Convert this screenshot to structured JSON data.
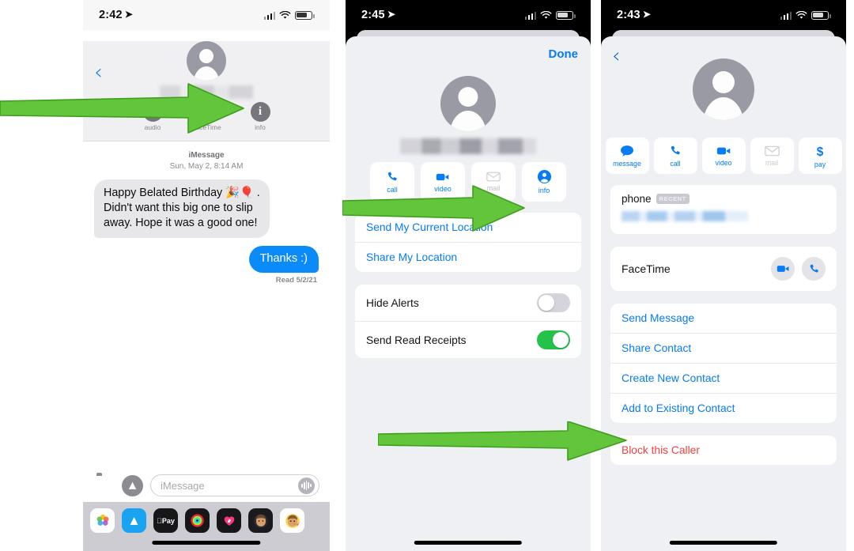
{
  "panels": {
    "messages": {
      "status": {
        "time": "2:42",
        "location_icon": "location-arrow-icon"
      },
      "back_icon": "back-chevron-icon",
      "contact_name_redacted": "",
      "header_actions": [
        {
          "label": "audio",
          "icon": "phone-icon"
        },
        {
          "label": "FaceTime",
          "icon": "video-icon"
        },
        {
          "label": "info",
          "icon": "info-icon"
        }
      ],
      "thread_service": "iMessage",
      "thread_date": "Sun, May 2, 8:14 AM",
      "messages": [
        {
          "from": "them",
          "text": "Happy Belated Birthday 🎉🎈 . Didn't want this big one to slip away. Hope it was a good one!"
        },
        {
          "from": "me",
          "text": "Thanks :)"
        }
      ],
      "read_receipt": "Read 5/2/21",
      "input_placeholder": "iMessage",
      "camera_icon": "camera-icon",
      "appstore_icon": "app-store-icon",
      "mic_icon": "audio-waveform-icon",
      "app_drawer": [
        {
          "name": "photos-app-icon"
        },
        {
          "name": "app-store-app-icon"
        },
        {
          "name": "apple-pay-app-icon",
          "label": "Pay"
        },
        {
          "name": "activity-rings-app-icon"
        },
        {
          "name": "fitness-app-icon"
        },
        {
          "name": "memoji-app-icon"
        },
        {
          "name": "memoji-sticker-app-icon"
        }
      ]
    },
    "details": {
      "status": {
        "time": "2:45",
        "location_icon": "location-arrow-icon"
      },
      "done_label": "Done",
      "contact_name_redacted": "",
      "actions": [
        {
          "label": "call",
          "icon": "phone-icon",
          "enabled": true
        },
        {
          "label": "video",
          "icon": "video-icon",
          "enabled": true
        },
        {
          "label": "mail",
          "icon": "mail-icon",
          "enabled": false
        },
        {
          "label": "info",
          "icon": "info-person-icon",
          "enabled": true
        }
      ],
      "location_items": [
        "Send My Current Location",
        "Share My Location"
      ],
      "toggles": [
        {
          "label": "Hide Alerts",
          "on": false
        },
        {
          "label": "Send Read Receipts",
          "on": true
        }
      ]
    },
    "contact": {
      "status": {
        "time": "2:43",
        "location_icon": "location-arrow-icon"
      },
      "back_icon": "back-chevron-icon",
      "actions": [
        {
          "label": "message",
          "icon": "message-bubble-icon",
          "enabled": true
        },
        {
          "label": "call",
          "icon": "phone-icon",
          "enabled": true
        },
        {
          "label": "video",
          "icon": "video-icon",
          "enabled": true
        },
        {
          "label": "mail",
          "icon": "mail-icon",
          "enabled": false
        },
        {
          "label": "pay",
          "icon": "dollar-icon",
          "enabled": true
        }
      ],
      "phone": {
        "label": "phone",
        "badge": "RECENT",
        "number_redacted": ""
      },
      "facetime": {
        "label": "FaceTime",
        "buttons": [
          {
            "icon": "video-icon"
          },
          {
            "icon": "phone-icon"
          }
        ]
      },
      "menu_items": [
        "Send Message",
        "Share Contact",
        "Create New Contact",
        "Add to Existing Contact"
      ],
      "destructive_item": "Block this Caller"
    }
  },
  "annotations": {
    "arrow_color": "#63c53b",
    "arrow_outline": "#3e9e1c",
    "arrows": [
      {
        "name": "arrow-to-info-button",
        "target": "info"
      },
      {
        "name": "arrow-to-info-tile",
        "target": "info"
      },
      {
        "name": "arrow-to-block-this-caller",
        "target": "Block this Caller"
      }
    ]
  },
  "colors": {
    "ios_blue": "#067bf5",
    "ios_green": "#23c34a",
    "ios_red": "#f0413f",
    "bubble_in": "#e7e7e9",
    "bubble_out": "#0b8afa",
    "sheet_bg": "#eff0f4"
  }
}
